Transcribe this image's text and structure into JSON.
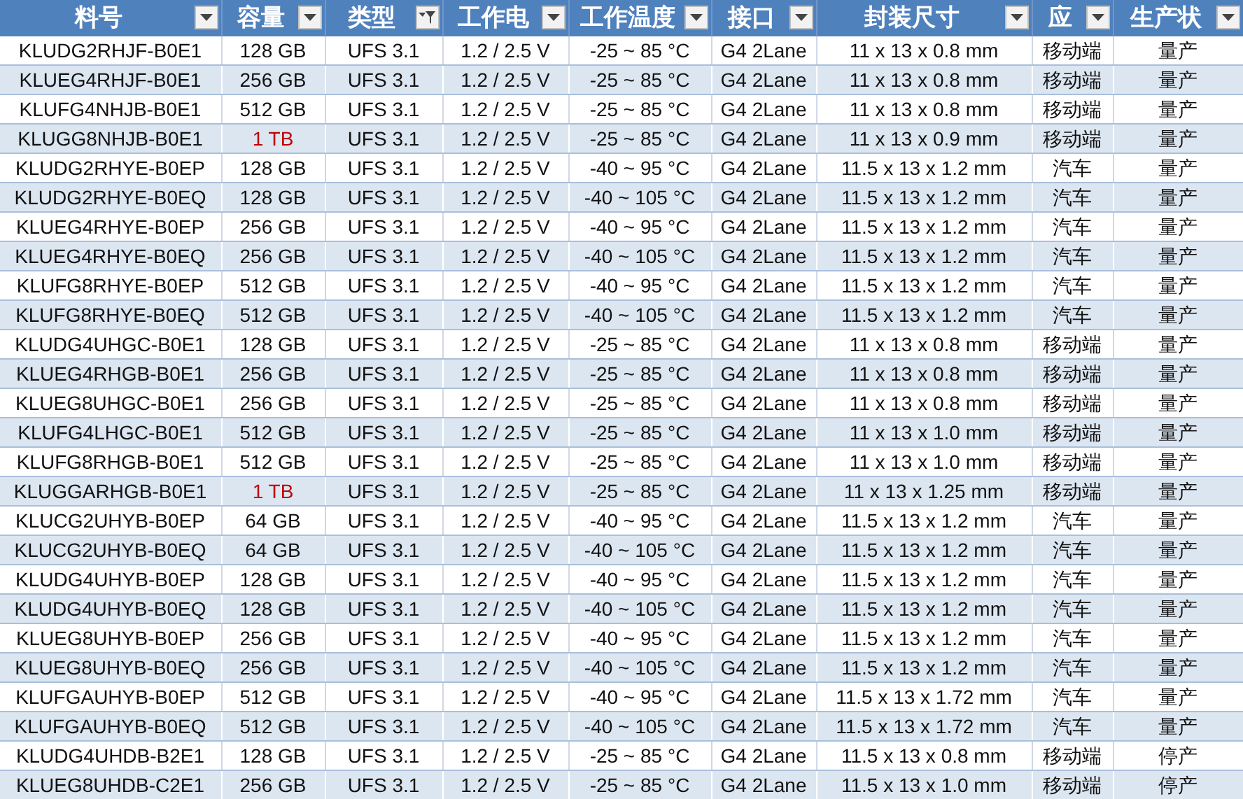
{
  "columns": [
    {
      "label": "料号",
      "filtered": false
    },
    {
      "label": "容量",
      "filtered": false
    },
    {
      "label": "类型",
      "filtered": true
    },
    {
      "label": "工作电",
      "filtered": false
    },
    {
      "label": "工作温度",
      "filtered": false
    },
    {
      "label": "接口",
      "filtered": false
    },
    {
      "label": "封装尺寸",
      "filtered": false
    },
    {
      "label": "应",
      "filtered": false
    },
    {
      "label": "生产状",
      "filtered": false
    }
  ],
  "rows": [
    {
      "cells": [
        "KLUDG2RHJF-B0E1",
        "128 GB",
        "UFS 3.1",
        "1.2 / 2.5 V",
        "-25 ~ 85 °C",
        "G4 2Lane",
        "11 x 13 x 0.8 mm",
        "移动端",
        "量产"
      ],
      "highlight": false
    },
    {
      "cells": [
        "KLUEG4RHJF-B0E1",
        "256 GB",
        "UFS 3.1",
        "1.2 / 2.5 V",
        "-25 ~ 85 °C",
        "G4 2Lane",
        "11 x 13 x 0.8 mm",
        "移动端",
        "量产"
      ],
      "highlight": false
    },
    {
      "cells": [
        "KLUFG4NHJB-B0E1",
        "512 GB",
        "UFS 3.1",
        "1.2 / 2.5 V",
        "-25 ~ 85 °C",
        "G4 2Lane",
        "11 x 13 x 0.8 mm",
        "移动端",
        "量产"
      ],
      "highlight": false
    },
    {
      "cells": [
        "KLUGG8NHJB-B0E1",
        "1 TB",
        "UFS 3.1",
        "1.2 / 2.5 V",
        "-25 ~ 85 °C",
        "G4 2Lane",
        "11 x 13 x 0.9 mm",
        "移动端",
        "量产"
      ],
      "highlight": true
    },
    {
      "cells": [
        "KLUDG2RHYE-B0EP",
        "128 GB",
        "UFS 3.1",
        "1.2 / 2.5 V",
        "-40 ~ 95 °C",
        "G4 2Lane",
        "11.5 x 13 x 1.2 mm",
        "汽车",
        "量产"
      ],
      "highlight": false
    },
    {
      "cells": [
        "KLUDG2RHYE-B0EQ",
        "128 GB",
        "UFS 3.1",
        "1.2 / 2.5 V",
        "-40 ~ 105 °C",
        "G4 2Lane",
        "11.5 x 13 x 1.2 mm",
        "汽车",
        "量产"
      ],
      "highlight": false
    },
    {
      "cells": [
        "KLUEG4RHYE-B0EP",
        "256 GB",
        "UFS 3.1",
        "1.2 / 2.5 V",
        "-40 ~ 95 °C",
        "G4 2Lane",
        "11.5 x 13 x 1.2 mm",
        "汽车",
        "量产"
      ],
      "highlight": false
    },
    {
      "cells": [
        "KLUEG4RHYE-B0EQ",
        "256 GB",
        "UFS 3.1",
        "1.2 / 2.5 V",
        "-40 ~ 105 °C",
        "G4 2Lane",
        "11.5 x 13 x 1.2 mm",
        "汽车",
        "量产"
      ],
      "highlight": false
    },
    {
      "cells": [
        "KLUFG8RHYE-B0EP",
        "512 GB",
        "UFS 3.1",
        "1.2 / 2.5 V",
        "-40 ~ 95 °C",
        "G4 2Lane",
        "11.5 x 13 x 1.2 mm",
        "汽车",
        "量产"
      ],
      "highlight": false
    },
    {
      "cells": [
        "KLUFG8RHYE-B0EQ",
        "512 GB",
        "UFS 3.1",
        "1.2 / 2.5 V",
        "-40 ~ 105 °C",
        "G4 2Lane",
        "11.5 x 13 x 1.2 mm",
        "汽车",
        "量产"
      ],
      "highlight": false
    },
    {
      "cells": [
        "KLUDG4UHGC-B0E1",
        "128 GB",
        "UFS 3.1",
        "1.2 / 2.5 V",
        "-25 ~ 85 °C",
        "G4 2Lane",
        "11 x 13 x 0.8 mm",
        "移动端",
        "量产"
      ],
      "highlight": false
    },
    {
      "cells": [
        "KLUEG4RHGB-B0E1",
        "256 GB",
        "UFS 3.1",
        "1.2 / 2.5 V",
        "-25 ~ 85 °C",
        "G4 2Lane",
        "11 x 13 x 0.8 mm",
        "移动端",
        "量产"
      ],
      "highlight": false
    },
    {
      "cells": [
        "KLUEG8UHGC-B0E1",
        "256 GB",
        "UFS 3.1",
        "1.2 / 2.5 V",
        "-25 ~ 85 °C",
        "G4 2Lane",
        "11 x 13 x 0.8 mm",
        "移动端",
        "量产"
      ],
      "highlight": false
    },
    {
      "cells": [
        "KLUFG4LHGC-B0E1",
        "512 GB",
        "UFS 3.1",
        "1.2 / 2.5 V",
        "-25 ~ 85 °C",
        "G4 2Lane",
        "11 x 13 x 1.0 mm",
        "移动端",
        "量产"
      ],
      "highlight": false
    },
    {
      "cells": [
        "KLUFG8RHGB-B0E1",
        "512 GB",
        "UFS 3.1",
        "1.2 / 2.5 V",
        "-25 ~ 85 °C",
        "G4 2Lane",
        "11 x 13 x 1.0 mm",
        "移动端",
        "量产"
      ],
      "highlight": false
    },
    {
      "cells": [
        "KLUGGARHGB-B0E1",
        "1 TB",
        "UFS 3.1",
        "1.2 / 2.5 V",
        "-25 ~ 85 °C",
        "G4 2Lane",
        "11 x 13 x 1.25 mm",
        "移动端",
        "量产"
      ],
      "highlight": true
    },
    {
      "cells": [
        "KLUCG2UHYB-B0EP",
        "64 GB",
        "UFS 3.1",
        "1.2 / 2.5 V",
        "-40 ~ 95 °C",
        "G4 2Lane",
        "11.5 x 13 x 1.2 mm",
        "汽车",
        "量产"
      ],
      "highlight": false
    },
    {
      "cells": [
        "KLUCG2UHYB-B0EQ",
        "64 GB",
        "UFS 3.1",
        "1.2 / 2.5 V",
        "-40 ~ 105 °C",
        "G4 2Lane",
        "11.5 x 13 x 1.2 mm",
        "汽车",
        "量产"
      ],
      "highlight": false
    },
    {
      "cells": [
        "KLUDG4UHYB-B0EP",
        "128 GB",
        "UFS 3.1",
        "1.2 / 2.5 V",
        "-40 ~ 95 °C",
        "G4 2Lane",
        "11.5 x 13 x 1.2 mm",
        "汽车",
        "量产"
      ],
      "highlight": false
    },
    {
      "cells": [
        "KLUDG4UHYB-B0EQ",
        "128 GB",
        "UFS 3.1",
        "1.2 / 2.5 V",
        "-40 ~ 105 °C",
        "G4 2Lane",
        "11.5 x 13 x 1.2 mm",
        "汽车",
        "量产"
      ],
      "highlight": false
    },
    {
      "cells": [
        "KLUEG8UHYB-B0EP",
        "256 GB",
        "UFS 3.1",
        "1.2 / 2.5 V",
        "-40 ~ 95 °C",
        "G4 2Lane",
        "11.5 x 13 x 1.2 mm",
        "汽车",
        "量产"
      ],
      "highlight": false
    },
    {
      "cells": [
        "KLUEG8UHYB-B0EQ",
        "256 GB",
        "UFS 3.1",
        "1.2 / 2.5 V",
        "-40 ~ 105 °C",
        "G4 2Lane",
        "11.5 x 13 x 1.2 mm",
        "汽车",
        "量产"
      ],
      "highlight": false
    },
    {
      "cells": [
        "KLUFGAUHYB-B0EP",
        "512 GB",
        "UFS 3.1",
        "1.2 / 2.5 V",
        "-40 ~ 95 °C",
        "G4 2Lane",
        "11.5 x 13 x 1.72 mm",
        "汽车",
        "量产"
      ],
      "highlight": false
    },
    {
      "cells": [
        "KLUFGAUHYB-B0EQ",
        "512 GB",
        "UFS 3.1",
        "1.2 / 2.5 V",
        "-40 ~ 105 °C",
        "G4 2Lane",
        "11.5 x 13 x 1.72 mm",
        "汽车",
        "量产"
      ],
      "highlight": false
    },
    {
      "cells": [
        "KLUDG4UHDB-B2E1",
        "128 GB",
        "UFS 3.1",
        "1.2 / 2.5 V",
        "-25 ~ 85 °C",
        "G4 2Lane",
        "11.5 x 13 x 0.8 mm",
        "移动端",
        "停产"
      ],
      "highlight": false
    },
    {
      "cells": [
        "KLUEG8UHDB-C2E1",
        "256 GB",
        "UFS 3.1",
        "1.2 / 2.5 V",
        "-25 ~ 85 °C",
        "G4 2Lane",
        "11.5 x 13 x 1.0 mm",
        "移动端",
        "停产"
      ],
      "highlight": false
    }
  ]
}
